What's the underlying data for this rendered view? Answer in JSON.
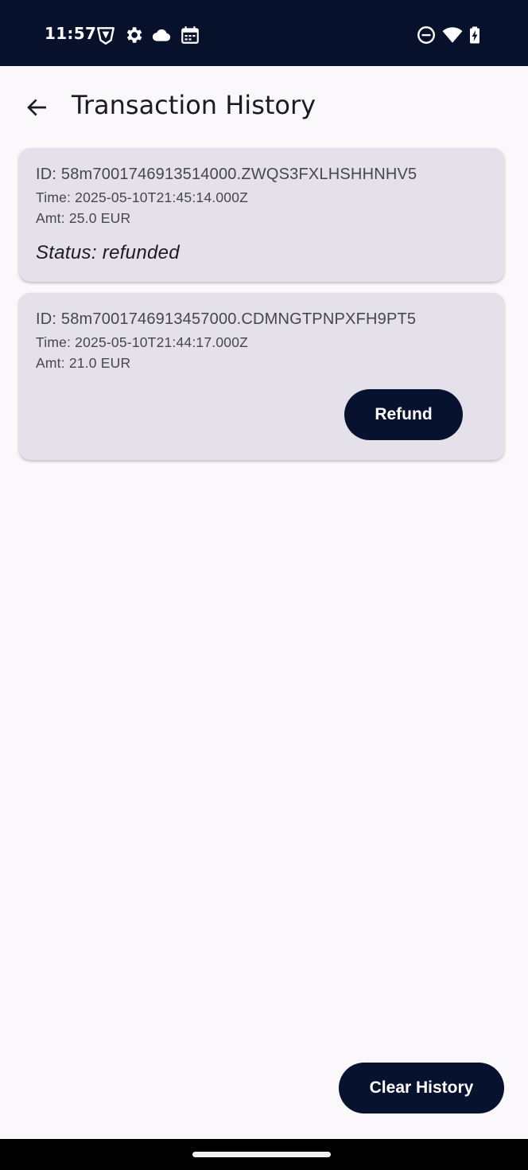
{
  "status_bar": {
    "time": "11:57",
    "left_icons": [
      "vpn-shield-icon",
      "settings-gear-icon",
      "cloud-icon",
      "calendar-icon"
    ],
    "right_icons": [
      "do-not-disturb-icon",
      "wifi-icon",
      "battery-charging-icon"
    ]
  },
  "app_bar": {
    "title": "Transaction History",
    "back_icon": "arrow-back-icon"
  },
  "transactions": [
    {
      "id": "ID: 58m7001746913514000.ZWQS3FXLHSHHNHV5",
      "time": "Time: 2025-05-10T21:45:14.000Z",
      "amount": "Amt: 25.0 EUR",
      "status": "Status: refunded"
    },
    {
      "id": "ID: 58m7001746913457000.CDMNGTPNPXFH9PT5",
      "time": "Time: 2025-05-10T21:44:17.000Z",
      "amount": "Amt: 21.0 EUR",
      "action_label": "Refund"
    }
  ],
  "footer": {
    "clear_label": "Clear History"
  },
  "colors": {
    "status_bar_bg": "#07112b",
    "page_bg": "#fbf8fc",
    "card_bg": "#e4e1ea",
    "button_bg": "#07132e",
    "text_primary": "#1b1b21",
    "text_secondary": "#46464f"
  }
}
